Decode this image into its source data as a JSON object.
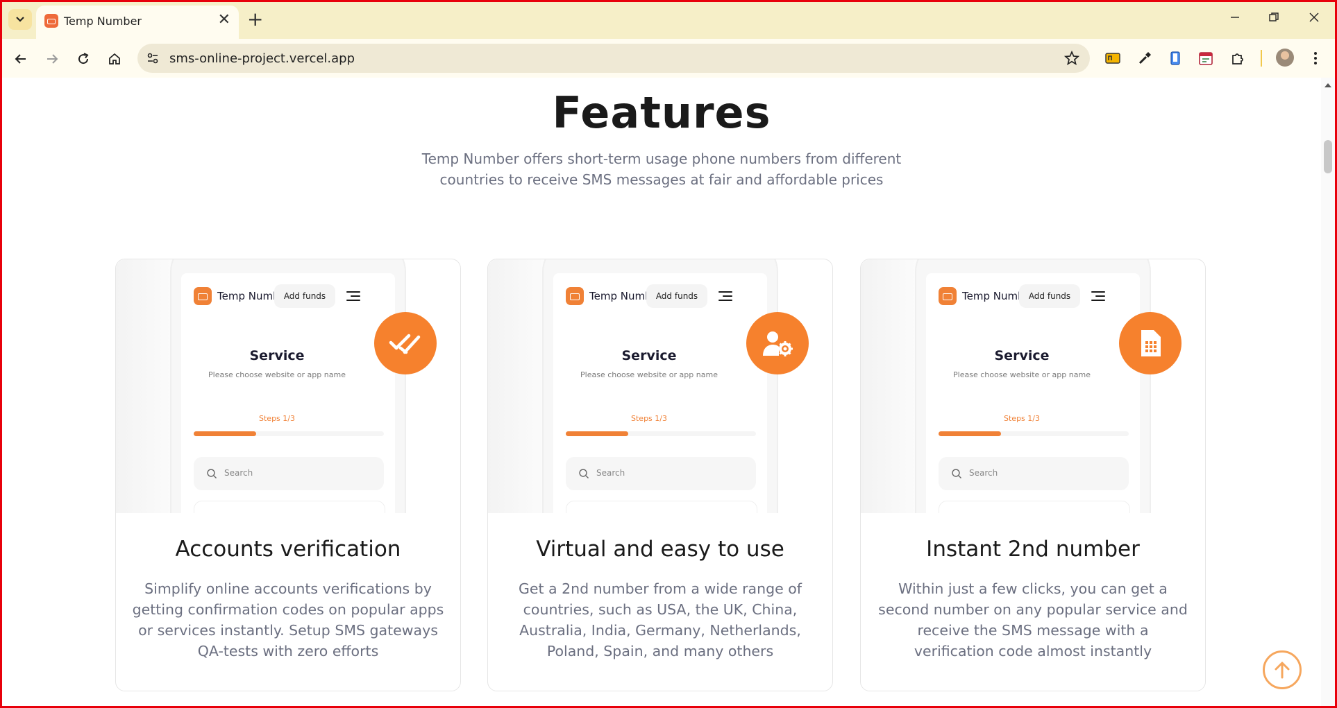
{
  "browser": {
    "tab_title": "Temp Number",
    "url": "sms-online-project.vercel.app"
  },
  "page": {
    "title": "Features",
    "subtitle": "Temp Number offers short-term usage phone numbers from different countries to receive SMS messages at fair and affordable prices"
  },
  "mockup": {
    "brand": "Temp Number",
    "add_funds": "Add funds",
    "service_title": "Service",
    "service_hint": "Please choose website or app name",
    "steps": "Steps 1/3",
    "progress": 0.33,
    "search_placeholder": "Search"
  },
  "cards": [
    {
      "icon": "double-check-icon",
      "title": "Accounts verification",
      "description": "Simplify online accounts verifications by getting confirmation codes on popular apps or services instantly. Setup SMS gateways QA-tests with zero efforts"
    },
    {
      "icon": "user-gear-icon",
      "title": "Virtual and easy to use",
      "description": "Get a 2nd number from a wide range of countries, such as USA, the UK, China, Australia, India, Germany, Netherlands, Poland, Spain, and many others"
    },
    {
      "icon": "sim-card-icon",
      "title": "Instant 2nd number",
      "description": "Within just a few clicks, you can get a second number on any popular service and receive the SMS message with a verification code almost instantly"
    }
  ],
  "colors": {
    "accent": "#f6812d",
    "frame": "#e8000b"
  }
}
